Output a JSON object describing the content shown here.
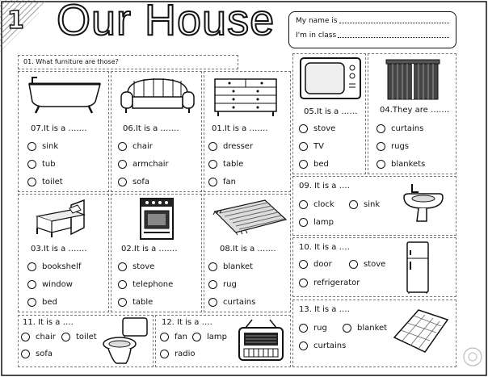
{
  "header": {
    "number": "1",
    "title": "Our House",
    "name_label": "My name is",
    "class_label": "I'm in class"
  },
  "instruction": "01. What furniture are those?",
  "items": [
    {
      "label": "07.It is a …….",
      "options": [
        "sink",
        "tub",
        "toilet"
      ],
      "icon": "bathtub-icon"
    },
    {
      "label": "06.It is a …….",
      "options": [
        "chair",
        "armchair",
        "sofa"
      ],
      "icon": "sofa-icon"
    },
    {
      "label": "01.It is a …….",
      "options": [
        "dresser",
        "table",
        "fan"
      ],
      "icon": "dresser-icon"
    },
    {
      "label": "05.It is a ……",
      "options": [
        "stove",
        "TV",
        "bed"
      ],
      "icon": "tv-icon"
    },
    {
      "label": "04.They are …….",
      "options": [
        "curtains",
        "rugs",
        "blankets"
      ],
      "icon": "curtains-icon"
    },
    {
      "label": "03.It is a …….",
      "options": [
        "bookshelf",
        "window",
        "bed"
      ],
      "icon": "bed-icon"
    },
    {
      "label": "02.It is a …….",
      "options": [
        "stove",
        "telephone",
        "table"
      ],
      "icon": "stove-icon"
    },
    {
      "label": "08.It is a …….",
      "options": [
        "blanket",
        "rug",
        "curtains"
      ],
      "icon": "rug-icon"
    },
    {
      "label": "09. It is a ….",
      "options": [
        "clock",
        "sink",
        "lamp"
      ],
      "icon": "sink-icon"
    },
    {
      "label": "10. It is a ….",
      "options": [
        "door",
        "stove",
        "refrigerator"
      ],
      "icon": "refrigerator-icon"
    },
    {
      "label": "13. It is a ….",
      "options": [
        "rug",
        "blanket",
        "curtains"
      ],
      "icon": "blanket-icon"
    },
    {
      "label": "11. It is a ….",
      "options": [
        "chair",
        "toilet",
        "sofa"
      ],
      "icon": "toilet-icon"
    },
    {
      "label": "12. It is a ….",
      "options": [
        "fan",
        "lamp",
        "radio"
      ],
      "icon": "radio-icon"
    }
  ]
}
